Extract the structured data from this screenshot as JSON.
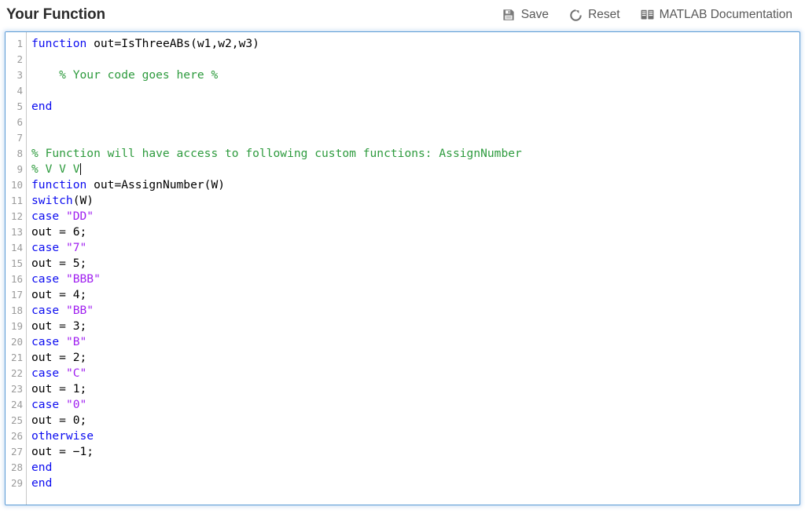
{
  "header": {
    "title": "Your Function",
    "toolbar": [
      {
        "id": "save",
        "label": "Save",
        "icon": "save-icon"
      },
      {
        "id": "reset",
        "label": "Reset",
        "icon": "reset-icon"
      },
      {
        "id": "matlab_doc",
        "label": "MATLAB Documentation",
        "icon": "book-icon"
      }
    ]
  },
  "editor": {
    "language": "matlab",
    "line_count": 29,
    "cursor_line": 9,
    "focused": true,
    "colors": {
      "keyword": "#0c0cf0",
      "string": "#a020f0",
      "comment": "#2e9b3e",
      "plain": "#000000",
      "gutter_text": "#9a9a9a",
      "focus_border": "#5b9bd5",
      "background": "#ffffff"
    },
    "line_numbers": [
      1,
      2,
      3,
      4,
      5,
      6,
      7,
      8,
      9,
      10,
      11,
      12,
      13,
      14,
      15,
      16,
      17,
      18,
      19,
      20,
      21,
      22,
      23,
      24,
      25,
      26,
      27,
      28,
      29
    ],
    "lines": [
      {
        "n": 1,
        "text": "function out=IsThreeABs(w1,w2,w3)",
        "tokens": [
          {
            "t": "function",
            "c": "kw"
          },
          {
            "t": " out=IsThreeABs(w1,w2,w3)",
            "c": "plain"
          }
        ]
      },
      {
        "n": 2,
        "text": "",
        "tokens": []
      },
      {
        "n": 3,
        "text": "    % Your code goes here %",
        "tokens": [
          {
            "t": "    % Your code goes here %",
            "c": "cmt"
          }
        ]
      },
      {
        "n": 4,
        "text": "",
        "tokens": []
      },
      {
        "n": 5,
        "text": "end",
        "tokens": [
          {
            "t": "end",
            "c": "kw"
          }
        ]
      },
      {
        "n": 6,
        "text": "",
        "tokens": []
      },
      {
        "n": 7,
        "text": "",
        "tokens": []
      },
      {
        "n": 8,
        "text": "% Function will have access to following custom functions: AssignNumber",
        "tokens": [
          {
            "t": "% Function will have access to following custom functions: AssignNumber",
            "c": "cmt"
          }
        ]
      },
      {
        "n": 9,
        "text": "% V V V",
        "tokens": [
          {
            "t": "% V V V",
            "c": "cmt"
          },
          {
            "t": "",
            "c": "caret"
          }
        ]
      },
      {
        "n": 10,
        "text": "function out=AssignNumber(W)",
        "tokens": [
          {
            "t": "function",
            "c": "kw"
          },
          {
            "t": " out=AssignNumber(W)",
            "c": "plain"
          }
        ]
      },
      {
        "n": 11,
        "text": "switch(W)",
        "tokens": [
          {
            "t": "switch",
            "c": "kw"
          },
          {
            "t": "(W)",
            "c": "plain"
          }
        ]
      },
      {
        "n": 12,
        "text": "case \"DD\"",
        "tokens": [
          {
            "t": "case",
            "c": "kw"
          },
          {
            "t": " ",
            "c": "plain"
          },
          {
            "t": "\"DD\"",
            "c": "str"
          }
        ]
      },
      {
        "n": 13,
        "text": "out = 6;",
        "tokens": [
          {
            "t": "out = 6;",
            "c": "plain"
          }
        ]
      },
      {
        "n": 14,
        "text": "case \"7\"",
        "tokens": [
          {
            "t": "case",
            "c": "kw"
          },
          {
            "t": " ",
            "c": "plain"
          },
          {
            "t": "\"7\"",
            "c": "str"
          }
        ]
      },
      {
        "n": 15,
        "text": "out = 5;",
        "tokens": [
          {
            "t": "out = 5;",
            "c": "plain"
          }
        ]
      },
      {
        "n": 16,
        "text": "case \"BBB\"",
        "tokens": [
          {
            "t": "case",
            "c": "kw"
          },
          {
            "t": " ",
            "c": "plain"
          },
          {
            "t": "\"BBB\"",
            "c": "str"
          }
        ]
      },
      {
        "n": 17,
        "text": "out = 4;",
        "tokens": [
          {
            "t": "out = 4;",
            "c": "plain"
          }
        ]
      },
      {
        "n": 18,
        "text": "case \"BB\"",
        "tokens": [
          {
            "t": "case",
            "c": "kw"
          },
          {
            "t": " ",
            "c": "plain"
          },
          {
            "t": "\"BB\"",
            "c": "str"
          }
        ]
      },
      {
        "n": 19,
        "text": "out = 3;",
        "tokens": [
          {
            "t": "out = 3;",
            "c": "plain"
          }
        ]
      },
      {
        "n": 20,
        "text": "case \"B\"",
        "tokens": [
          {
            "t": "case",
            "c": "kw"
          },
          {
            "t": " ",
            "c": "plain"
          },
          {
            "t": "\"B\"",
            "c": "str"
          }
        ]
      },
      {
        "n": 21,
        "text": "out = 2;",
        "tokens": [
          {
            "t": "out = 2;",
            "c": "plain"
          }
        ]
      },
      {
        "n": 22,
        "text": "case \"C\"",
        "tokens": [
          {
            "t": "case",
            "c": "kw"
          },
          {
            "t": " ",
            "c": "plain"
          },
          {
            "t": "\"C\"",
            "c": "str"
          }
        ]
      },
      {
        "n": 23,
        "text": "out = 1;",
        "tokens": [
          {
            "t": "out = 1;",
            "c": "plain"
          }
        ]
      },
      {
        "n": 24,
        "text": "case \"0\"",
        "tokens": [
          {
            "t": "case",
            "c": "kw"
          },
          {
            "t": " ",
            "c": "plain"
          },
          {
            "t": "\"0\"",
            "c": "str"
          }
        ]
      },
      {
        "n": 25,
        "text": "out = 0;",
        "tokens": [
          {
            "t": "out = 0;",
            "c": "plain"
          }
        ]
      },
      {
        "n": 26,
        "text": "otherwise",
        "tokens": [
          {
            "t": "otherwise",
            "c": "kw"
          }
        ]
      },
      {
        "n": 27,
        "text": "out = −1;",
        "tokens": [
          {
            "t": "out = −1;",
            "c": "plain"
          }
        ]
      },
      {
        "n": 28,
        "text": "end",
        "tokens": [
          {
            "t": "end",
            "c": "kw"
          }
        ]
      },
      {
        "n": 29,
        "text": "end",
        "tokens": [
          {
            "t": "end",
            "c": "kw"
          }
        ]
      }
    ]
  }
}
